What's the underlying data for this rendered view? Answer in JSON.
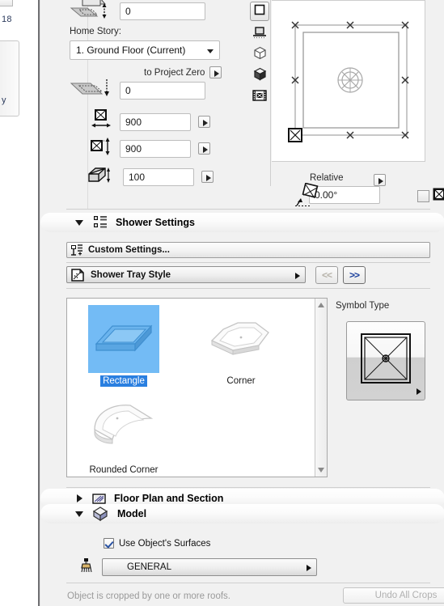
{
  "background_window": {
    "number_label": "18",
    "letter_label": "y"
  },
  "top_form": {
    "elevation_value": "0",
    "home_story_label": "Home Story:",
    "home_story_value": "1. Ground Floor (Current)",
    "project_zero_label": "to Project Zero",
    "project_zero_value": "0",
    "width_value": "900",
    "depth_value": "900",
    "height_value": "100"
  },
  "view_tabs": [
    {
      "name": "2d-symbol-view",
      "selected": true
    },
    {
      "name": "front-elevation-view",
      "selected": false
    },
    {
      "name": "3d-wireframe-view",
      "selected": false
    },
    {
      "name": "3d-shaded-view",
      "selected": false
    },
    {
      "name": "preview-picture-view",
      "selected": false
    }
  ],
  "preview": {
    "relative_label": "Relative",
    "angle_value": "0.00°"
  },
  "shower_settings": {
    "header_title": "Shower Settings",
    "expanded": true,
    "custom_settings_label": "Custom Settings...",
    "tray_style_label": "Shower Tray Style",
    "prev_label": "<<",
    "next_label": ">>",
    "prev_enabled": false,
    "next_enabled": true,
    "thumbnails": [
      {
        "label": "Rectangle",
        "selected": true
      },
      {
        "label": "Corner",
        "selected": false
      },
      {
        "label": "Rounded Corner",
        "selected": false
      }
    ],
    "symbol_type_label": "Symbol Type"
  },
  "floor_plan_section": {
    "header_title": "Floor Plan and Section",
    "expanded": false
  },
  "model_section": {
    "header_title": "Model",
    "expanded": true,
    "use_surfaces_label": "Use Object's Surfaces",
    "use_surfaces_checked": true,
    "material_value": "GENERAL"
  },
  "footer": {
    "note": "Object is cropped by one or more roofs.",
    "undo_label": "Undo All Crops",
    "undo_enabled": false
  },
  "colors": {
    "panel_bg": "#f1f1f1",
    "selection_blue": "#73bbf5",
    "selection_label_blue": "#2a7fe0",
    "nav_active": "#1a3f9c",
    "divider": "#6f6f72"
  }
}
